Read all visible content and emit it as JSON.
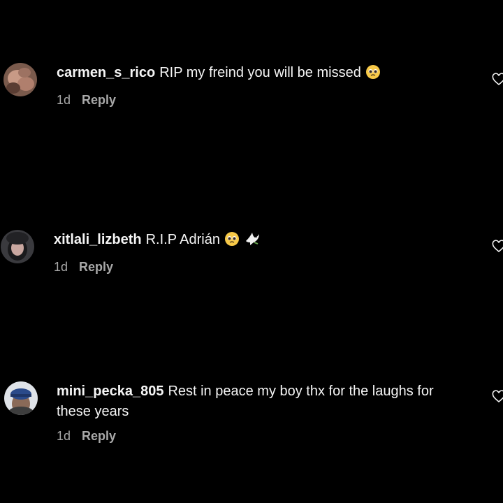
{
  "comments": [
    {
      "username": "carmen_s_rico",
      "text": "RIP my freind you will be missed",
      "emojis": [
        "pleading-face"
      ],
      "time": "1d",
      "reply_label": "Reply"
    },
    {
      "username": "xitlali_lizbeth",
      "text": "R.I.P Adrián",
      "emojis": [
        "pleading-face",
        "dove"
      ],
      "time": "1d",
      "reply_label": "Reply"
    },
    {
      "username": "mini_pecka_805",
      "text": "Rest in peace my boy thx for the laughs for these years",
      "emojis": [],
      "time": "1d",
      "reply_label": "Reply"
    }
  ],
  "colors": {
    "background": "#000000",
    "text": "#f5f5f5",
    "secondary_text": "#a8a8a8"
  },
  "icons": {
    "like": "heart-outline-icon",
    "emoji_sad": "pleading-face-emoji",
    "emoji_dove": "dove-emoji"
  }
}
